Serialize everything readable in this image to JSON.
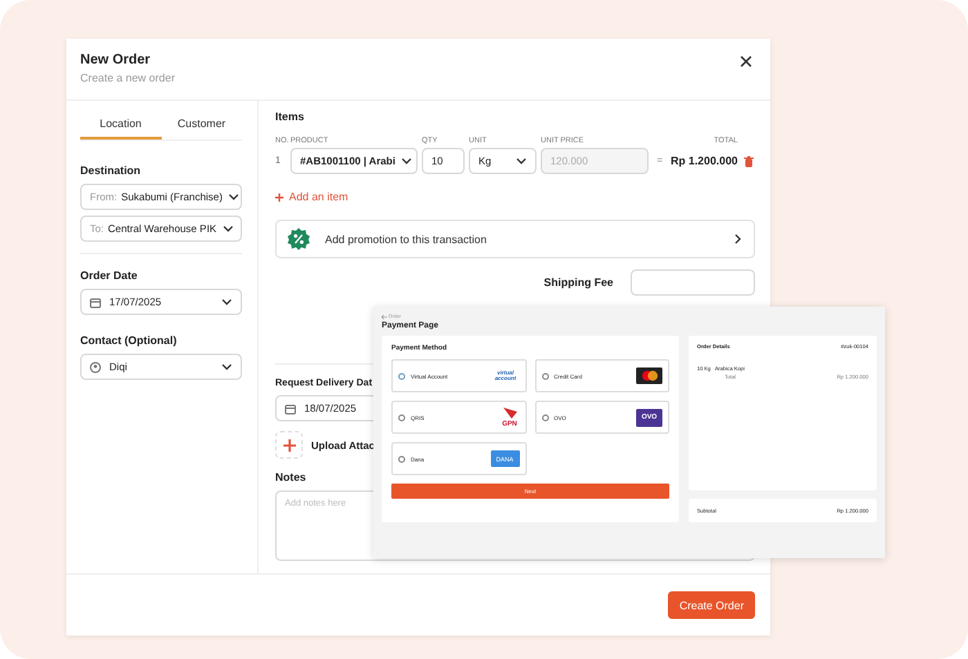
{
  "modal": {
    "title": "New Order",
    "subtitle": "Create a new order"
  },
  "tabs": [
    {
      "label": "Location",
      "selected": true
    },
    {
      "label": "Customer",
      "selected": false
    }
  ],
  "location": {
    "destination_label": "Destination",
    "from_prefix": "From:",
    "from_value": "Sukabumi (Franchise)",
    "to_prefix": "To:",
    "to_value": "Central Warehouse PIK",
    "order_date_label": "Order Date",
    "order_date": "17/07/2025",
    "contact_label": "Contact (Optional)",
    "contact": "Diqi"
  },
  "items": {
    "title": "Items",
    "columns": [
      "NO.",
      "PRODUCT",
      "QTY",
      "UNIT",
      "UNIT PRICE",
      "TOTAL"
    ],
    "rows": [
      {
        "no": "1",
        "product": "#AB1001100 | Arabi",
        "qty": "10",
        "unit": "Kg",
        "unit_price_placeholder": "120.000",
        "equals": "=",
        "total": "Rp 1.200.000"
      }
    ],
    "add_item": "Add an item"
  },
  "promotion": "Add promotion to this transaction",
  "shipping_fee_label": "Shipping Fee",
  "request_delivery_label": "Request Delivery Dat",
  "request_delivery_date": "18/07/2025",
  "upload_label": "Upload Attac",
  "notes_label": "Notes",
  "notes_placeholder": "Add notes here",
  "create_button": "Create Order",
  "payment_page": {
    "back": "Order",
    "title": "Payment Page",
    "method_title": "Payment Method",
    "methods": [
      {
        "label": "Virtual Account",
        "selected": true,
        "kind": "va",
        "logo_text": "virtual account"
      },
      {
        "label": "Credit Card",
        "selected": false,
        "kind": "card"
      },
      {
        "label": "QRIS",
        "selected": false,
        "kind": "qris",
        "logo_text": "GPN"
      },
      {
        "label": "OVO",
        "selected": false,
        "kind": "ovo",
        "logo_text": "OVO"
      },
      {
        "label": "Dana",
        "selected": false,
        "kind": "dana",
        "logo_text": "DANA"
      }
    ],
    "next": "Next",
    "details_title": "Order Details",
    "order_id": "#zuk-00104",
    "line_qty": "10 Kg",
    "line_name": "Arabica Kopi",
    "total_label": "Total",
    "total": "Rp 1.200.000",
    "subtotal_label": "Subtotal",
    "subtotal": "Rp 1.200.000"
  }
}
